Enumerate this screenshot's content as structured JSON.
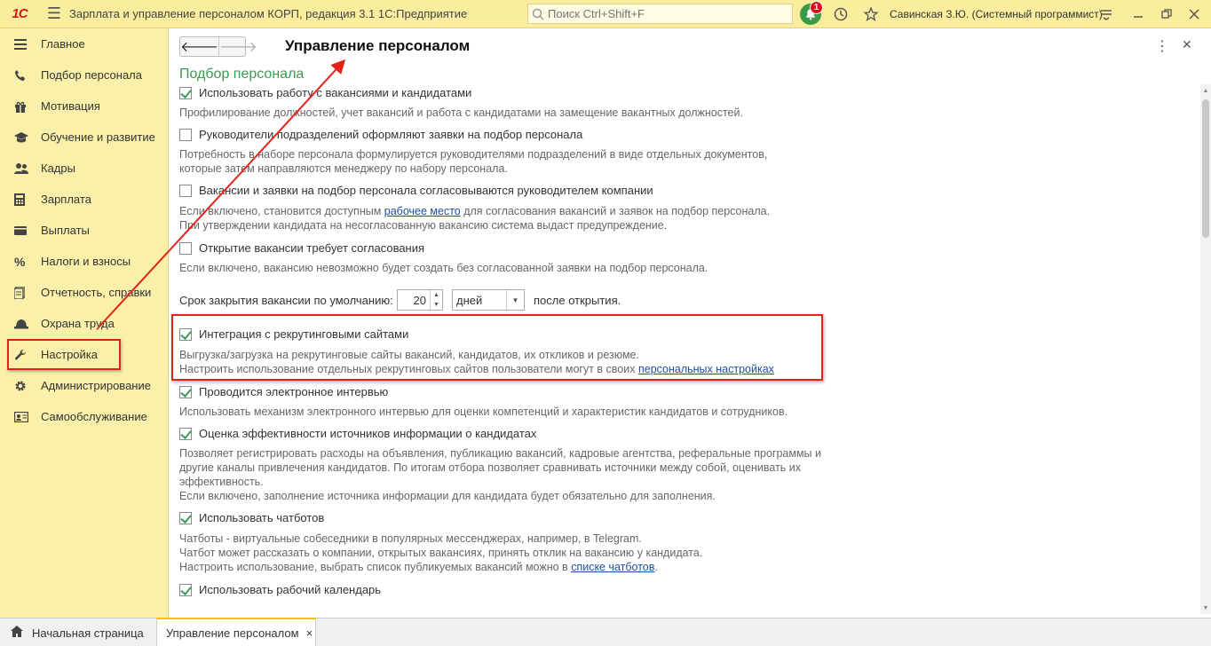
{
  "topbar": {
    "logo": "1С",
    "title": "Зарплата и управление персоналом КОРП, редакция 3.1 1С:Предприятие",
    "search_placeholder": "Поиск Ctrl+Shift+F",
    "notifications_count": "1",
    "user": "Савинская З.Ю. (Системный программист)",
    "icons": [
      "menu-icon",
      "bell-icon",
      "history-icon",
      "star-icon",
      "settings-icon",
      "minimize-icon",
      "restore-icon",
      "close-icon"
    ]
  },
  "sidebar": {
    "items": [
      {
        "label": "Главное",
        "icon": "menu-icon"
      },
      {
        "label": "Подбор персонала",
        "icon": "phone-icon"
      },
      {
        "label": "Мотивация",
        "icon": "gift-icon"
      },
      {
        "label": "Обучение и развитие",
        "icon": "graduation-icon"
      },
      {
        "label": "Кадры",
        "icon": "people-icon"
      },
      {
        "label": "Зарплата",
        "icon": "calculator-icon"
      },
      {
        "label": "Выплаты",
        "icon": "wallet-icon"
      },
      {
        "label": "Налоги и взносы",
        "icon": "percent-icon"
      },
      {
        "label": "Отчетность, справки",
        "icon": "report-icon"
      },
      {
        "label": "Охрана труда",
        "icon": "helmet-icon"
      },
      {
        "label": "Настройка",
        "icon": "wrench-icon"
      },
      {
        "label": "Администрирование",
        "icon": "gear-icon"
      },
      {
        "label": "Самообслуживание",
        "icon": "id-card-icon"
      }
    ],
    "active": "Настройка"
  },
  "main": {
    "page_title": "Управление персоналом",
    "section_title": "Подбор персонала",
    "options": [
      {
        "label": "Использовать работу с вакансиями и кандидатами",
        "checked": true,
        "desc": [
          "Профилирование должностей, учет вакансий и работа с кандидатами на замещение вакантных должностей."
        ]
      },
      {
        "label": "Руководители подразделений оформляют заявки на подбор персонала",
        "checked": false,
        "desc": [
          "Потребность в наборе персонала формулируется руководителями подразделений в виде отдельных документов,",
          "которые затем направляются менеджеру по набору персонала."
        ]
      },
      {
        "label": "Вакансии и заявки на подбор персонала согласовываются руководителем компании",
        "checked": false,
        "desc_pre": "Если включено, становится доступным ",
        "desc_link": "рабочее место",
        "desc_post": " для согласования вакансий и заявок на подбор персонала.",
        "desc2": "При утверждении кандидата на несогласованную вакансию система выдаст предупреждение."
      },
      {
        "label": "Открытие вакансии требует согласования",
        "checked": false,
        "desc": [
          "Если включено, вакансию невозможно будет создать без согласованной заявки на подбор персонала."
        ]
      },
      {
        "label": "Интеграция с рекрутинговыми сайтами",
        "checked": true,
        "desc1": "Выгрузка/загрузка на рекрутинговые сайты вакансий, кандидатов, их откликов и резюме.",
        "desc2_pre": "Настроить использование отдельных рекрутинговых сайтов пользователи могут в своих ",
        "desc2_link": "персональных настройках"
      },
      {
        "label": "Проводится электронное интервью",
        "checked": true,
        "desc": [
          "Использовать механизм электронного интервью для оценки компетенций и характеристик кандидатов и сотрудников."
        ]
      },
      {
        "label": "Оценка эффективности источников информации о кандидатах",
        "checked": true,
        "desc": [
          "Позволяет регистрировать расходы на объявления, публикацию вакансий, кадровые агентства, реферальные программы и",
          "другие каналы привлечения кандидатов. По итогам отбора позволяет сравнивать источники между собой, оценивать их",
          "эффективность.",
          "Если включено, заполнение источника информации для кандидата будет обязательно для заполнения."
        ]
      },
      {
        "label": "Использовать чатботов",
        "checked": true,
        "desc": [
          "Чатботы - виртуальные собеседники в популярных мессенджерах, например, в Telegram.",
          "Чатбот может рассказать о компании, открытых вакансиях, принять отклик на вакансию у кандидата."
        ],
        "desc_last_pre": "Настроить использование, выбрать список публикуемых вакансий можно в ",
        "desc_last_link": "списке чатботов",
        "desc_last_post": "."
      },
      {
        "label": "Использовать рабочий календарь",
        "checked": true
      }
    ],
    "term": {
      "label": "Срок закрытия вакансии по умолчанию:",
      "value": "20",
      "unit": "дней",
      "after": "после открытия."
    }
  },
  "bottom_tabs": {
    "home": "Начальная страница",
    "active": "Управление персоналом",
    "close_glyph": "×"
  },
  "colors": {
    "topbar": "#fbed9e",
    "sidebar": "#fbf0a9",
    "accent_green": "#3b9b52",
    "highlight_red": "#e3231b",
    "link": "#1d4fa3"
  }
}
